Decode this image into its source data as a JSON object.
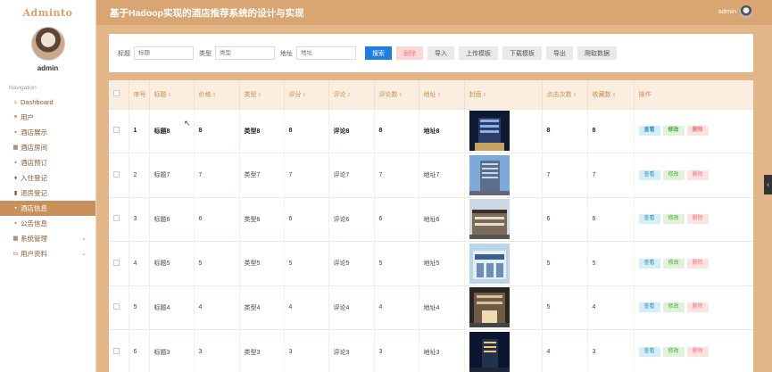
{
  "app": {
    "logo": "Adminto",
    "title": "基于Hadoop实现的酒店推荐系统的设计与实现"
  },
  "header": {
    "username": "admin"
  },
  "sidebar": {
    "username": "admin",
    "nav_caption": "Navigation",
    "items": [
      {
        "label": "Dashboard",
        "icon": "home-icon"
      },
      {
        "label": "用户",
        "icon": "list-icon"
      },
      {
        "label": "酒店展示",
        "icon": "square-icon"
      },
      {
        "label": "酒店房间",
        "icon": "grid-icon"
      },
      {
        "label": "酒店预订",
        "icon": "square-icon"
      },
      {
        "label": "入住登记",
        "icon": "pin-icon"
      },
      {
        "label": "退房登记",
        "icon": "chart-icon"
      },
      {
        "label": "酒店信息",
        "icon": "square-icon",
        "active": true
      },
      {
        "label": "公告信息",
        "icon": "square-icon"
      },
      {
        "label": "系统管理",
        "icon": "grid-icon",
        "expandable": true
      },
      {
        "label": "用户资料",
        "icon": "card-icon",
        "expandable": true
      }
    ]
  },
  "search": {
    "title_label": "标题",
    "title_placeholder": "标题",
    "type_label": "类型",
    "type_placeholder": "类型",
    "address_label": "地址",
    "address_placeholder": "地址",
    "buttons": {
      "search": "搜索",
      "delete": "删除",
      "import": "导入",
      "upload_template": "上传模板",
      "download_template": "下载模板",
      "export": "导出",
      "crawl": "爬取数据"
    }
  },
  "table": {
    "headers": {
      "index": "序号",
      "title": "标题",
      "price": "价格",
      "type": "类型",
      "score": "评分",
      "comment": "评论",
      "comment_count": "评论数",
      "address": "地址",
      "cover": "封面",
      "clicks": "点击次数",
      "favorites": "收藏数",
      "actions": "操作"
    },
    "action_labels": {
      "view": "查看",
      "edit": "修改",
      "delete": "删除"
    },
    "rows": [
      {
        "index": "1",
        "title": "标题8",
        "price": "8",
        "type": "类型8",
        "score": "8",
        "comment": "评论8",
        "comment_count": "8",
        "address": "地址8",
        "clicks": "8",
        "favorites": "8"
      },
      {
        "index": "2",
        "title": "标题7",
        "price": "7",
        "type": "类型7",
        "score": "7",
        "comment": "评论7",
        "comment_count": "7",
        "address": "地址7",
        "clicks": "7",
        "favorites": "7"
      },
      {
        "index": "3",
        "title": "标题6",
        "price": "6",
        "type": "类型6",
        "score": "6",
        "comment": "评论6",
        "comment_count": "6",
        "address": "地址6",
        "clicks": "6",
        "favorites": "6"
      },
      {
        "index": "4",
        "title": "标题5",
        "price": "5",
        "type": "类型5",
        "score": "5",
        "comment": "评论5",
        "comment_count": "5",
        "address": "地址5",
        "clicks": "5",
        "favorites": "5"
      },
      {
        "index": "5",
        "title": "标题4",
        "price": "4",
        "type": "类型4",
        "score": "4",
        "comment": "评论4",
        "comment_count": "4",
        "address": "地址4",
        "clicks": "5",
        "favorites": "4"
      },
      {
        "index": "6",
        "title": "标题3",
        "price": "3",
        "type": "类型3",
        "score": "3",
        "comment": "评论3",
        "comment_count": "3",
        "address": "地址3",
        "clicks": "4",
        "favorites": "3"
      }
    ]
  },
  "colors": {
    "accent": "#d9a673",
    "active_nav": "#c8915c",
    "primary_button": "#1e7fe0"
  }
}
